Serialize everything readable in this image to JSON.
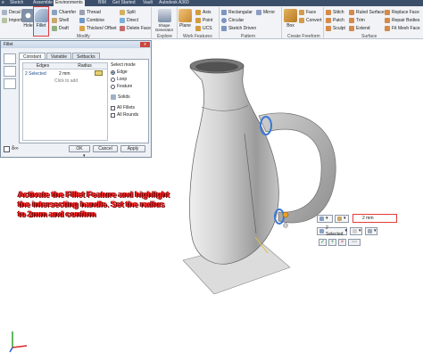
{
  "tabs": [
    "e",
    "Sketch",
    "Assemble",
    "Environments",
    "BIM",
    "Get Started",
    "Vault",
    "Autodesk A360"
  ],
  "ribbon": {
    "left_small": [
      "Decal",
      "Import"
    ],
    "hole": "Hole",
    "fillet": "Fillet",
    "modify_col1": [
      "Chamfer",
      "Shell",
      "Draft"
    ],
    "modify_col2": [
      "Thread",
      "Combine",
      "Thicken/ Offset"
    ],
    "modify_col3": [
      "Split",
      "Direct",
      "Delete Face"
    ],
    "modify_group": "Modify",
    "shape_generator": "Shape Generator",
    "explore_group": "Explore",
    "plane": "Plane",
    "workfeat_col": [
      "Axis",
      "Point",
      "UCS"
    ],
    "workfeat_group": "Work Features",
    "pattern_col1": [
      "Rectangular",
      "Circular",
      "Sketch Driven"
    ],
    "mirror": "Mirror",
    "pattern_group": "Pattern",
    "box": "Box",
    "freeform_col": [
      "Face",
      "Convert"
    ],
    "freeform_group": "Create Freeform",
    "surface_col1": [
      "Stitch",
      "Patch",
      "Sculpt"
    ],
    "surface_col2": [
      "Ruled Surface",
      "Trim",
      "Extend"
    ],
    "surface_col3": [
      "Replace Face",
      "Repair Bodies",
      "Fit Mesh Face"
    ],
    "surface_group": "Surface"
  },
  "colors": {
    "accent_highlight": "#e53b3b",
    "instruction_text": "#ff2a2a",
    "handle_blue": "#3a78d6"
  },
  "dialog": {
    "title": "Fillet",
    "close": "x",
    "tabs": [
      "Constant",
      "Variable",
      "Setbacks"
    ],
    "headers": {
      "edges": "Edges",
      "radius": "Radius"
    },
    "row": {
      "edges": "2 Selected",
      "radius": "2 mm"
    },
    "click_to_add": "Click to add",
    "select_mode_label": "Select mode",
    "select_modes": [
      "Edge",
      "Loop",
      "Feature"
    ],
    "solids": "Solids",
    "all_fillets": "All Fillets",
    "all_rounds": "All Rounds",
    "footer_icon": "δ∞",
    "ok": "OK",
    "cancel": "Cancel",
    "apply": "Apply"
  },
  "instruction": "Activate the Fillet Feature and highlight the intersecting handle. Set the radius to 2mm and confirm",
  "minitoolbar": {
    "radius_value": "2 mm",
    "selected": "2 Selected",
    "icons": [
      "check-icon",
      "plus-icon",
      "cancel-icon",
      "more-icon"
    ]
  }
}
